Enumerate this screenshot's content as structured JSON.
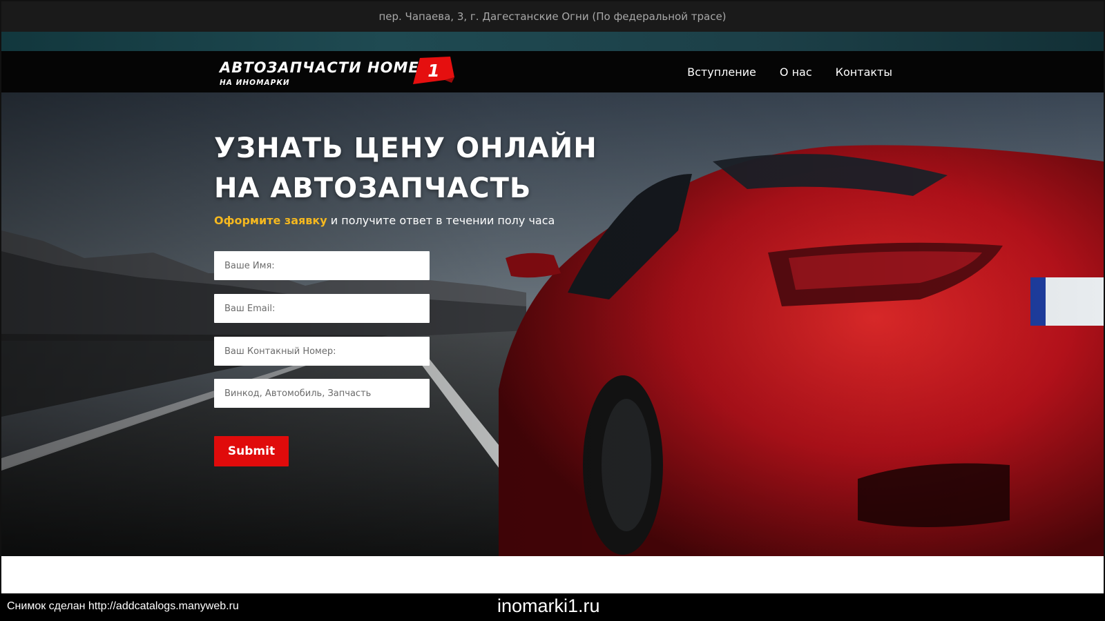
{
  "topbar": {
    "address": "пер. Чапаева, 3, г. Дагестанские Огни (По федеральной трасе)"
  },
  "logo": {
    "title": "АВТОЗАПЧАСТИ НОМЕР",
    "subtitle": "НА ИНОМАРКИ",
    "badge_number": "1",
    "badge_color": "#e50f0f"
  },
  "nav": {
    "items": [
      {
        "label": "Вступление"
      },
      {
        "label": "О нас"
      },
      {
        "label": "Контакты"
      }
    ]
  },
  "hero": {
    "title_line1": "УЗНАТЬ ЦЕНУ ОНЛАЙН",
    "title_line2": "НА АВТОЗАПЧАСТЬ",
    "subtitle_accent": "Оформите заявку",
    "subtitle_rest": "и получите ответ в течении полу часа",
    "accent_color": "#f5b81f",
    "image_description_icon": "red-sports-car-on-road-image"
  },
  "form": {
    "name_placeholder": "Ваше Имя:",
    "email_placeholder": "Ваш Email:",
    "phone_placeholder": "Ваш Контакный Номер:",
    "query_placeholder": "Винкод, Автомобиль, Запчасть",
    "submit_label": "Submit",
    "submit_color": "#e00b0b"
  },
  "footer": {
    "caption_left": "Снимок сделан http://addcatalogs.manyweb.ru",
    "caption_center": "inomarki1.ru"
  }
}
